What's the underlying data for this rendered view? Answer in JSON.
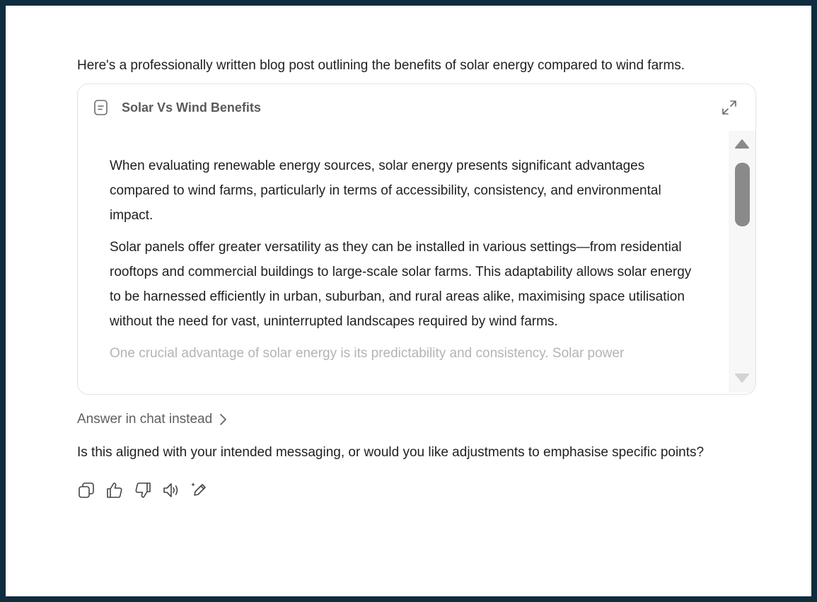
{
  "message": {
    "intro": "Here's a professionally written blog post outlining the benefits of solar energy compared to wind farms."
  },
  "artifact": {
    "title": "Solar Vs Wind Benefits",
    "icon": "document-icon",
    "expand_icon": "expand-icon",
    "paragraphs": [
      "When evaluating renewable energy sources, solar energy presents significant advantages compared to wind farms, particularly in terms of accessibility, consistency, and environmental impact.",
      "Solar panels offer greater versatility as they can be installed in various settings—from residential rooftops and commercial buildings to large-scale solar farms. This adaptability allows solar energy to be harnessed efficiently in urban, suburban, and rural areas alike, maximising space utilisation without the need for vast, uninterrupted landscapes required by wind farms."
    ],
    "partial_line": "One crucial advantage of solar energy is its predictability and consistency. Solar power"
  },
  "answer_link": "Answer in chat instead",
  "followup": "Is this aligned with your intended messaging, or would you like adjustments to emphasise specific points?",
  "actions": [
    "copy-icon",
    "thumbs-up-icon",
    "thumbs-down-icon",
    "read-aloud-icon",
    "edit-icon"
  ]
}
